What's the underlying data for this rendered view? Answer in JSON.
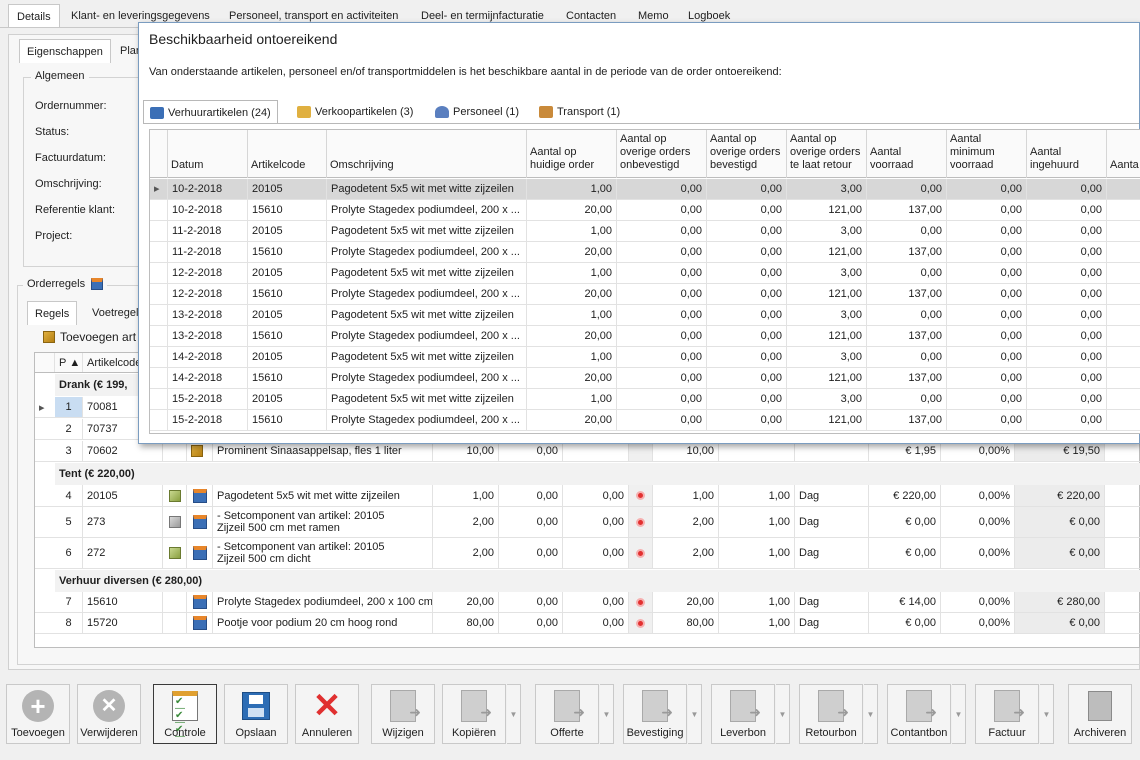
{
  "top_tabs": [
    "Details",
    "Klant- en leveringsgegevens",
    "Personeel, transport en activiteiten",
    "Deel- en termijnfacturatie",
    "Contacten",
    "Memo",
    "Logboek"
  ],
  "sub_tabs": [
    "Eigenschappen",
    "Plan"
  ],
  "general_group": "Algemeen",
  "fields": [
    "Ordernummer:",
    "Status:",
    "Factuurdatum:",
    "Omschrijving:",
    "Referentie klant:",
    "Project:"
  ],
  "orderregels": {
    "title": "Orderregels",
    "tabs": [
      "Regels",
      "Voetregel"
    ],
    "add_label": "Toevoegen art",
    "col_p": "P",
    "col_artikelcode": "Artikelcode",
    "groups": {
      "drank": "Drank  (€ 199,",
      "tent": "Tent  (€ 220,00)",
      "verhuur": "Verhuur diversen  (€ 280,00)"
    },
    "rows": [
      {
        "p": "1",
        "code": "70081"
      },
      {
        "p": "2",
        "code": "70737"
      },
      {
        "p": "3",
        "code": "70602",
        "desc": "Prominent Sinaasappelsap, fles 1 liter",
        "q": "10,00",
        "a": "0,00",
        "c": "10,00",
        "price": "€ 1,95",
        "disc": "0,00%",
        "total": "€ 19,50"
      },
      {
        "p": "4",
        "code": "20105",
        "desc": "Pagodetent 5x5 wit met witte zijzeilen",
        "q": "1,00",
        "a": "0,00",
        "b": "0,00",
        "c": "1,00",
        "d": "1,00",
        "unit": "Dag",
        "price": "€ 220,00",
        "disc": "0,00%",
        "total": "€ 220,00"
      },
      {
        "p": "5",
        "code": "273",
        "desc1": "- Setcomponent van artikel: 20105",
        "desc2": "Zijzeil 500 cm met ramen",
        "q": "2,00",
        "a": "0,00",
        "b": "0,00",
        "c": "2,00",
        "d": "1,00",
        "unit": "Dag",
        "price": "€ 0,00",
        "disc": "0,00%",
        "total": "€ 0,00"
      },
      {
        "p": "6",
        "code": "272",
        "desc1": "- Setcomponent van artikel: 20105",
        "desc2": "Zijzeil 500 cm dicht",
        "q": "2,00",
        "a": "0,00",
        "b": "0,00",
        "c": "2,00",
        "d": "1,00",
        "unit": "Dag",
        "price": "€ 0,00",
        "disc": "0,00%",
        "total": "€ 0,00"
      },
      {
        "p": "7",
        "code": "15610",
        "desc": "Prolyte Stagedex podiumdeel, 200 x 100 cm",
        "q": "20,00",
        "a": "0,00",
        "b": "0,00",
        "c": "20,00",
        "d": "1,00",
        "unit": "Dag",
        "price": "€ 14,00",
        "disc": "0,00%",
        "total": "€ 280,00"
      },
      {
        "p": "8",
        "code": "15720",
        "desc": "Pootje voor podium 20 cm hoog rond",
        "q": "80,00",
        "a": "0,00",
        "b": "0,00",
        "c": "80,00",
        "d": "1,00",
        "unit": "Dag",
        "price": "€ 0,00",
        "disc": "0,00%",
        "total": "€ 0,00"
      }
    ]
  },
  "dialog": {
    "title": "Beschikbaarheid ontoereikend",
    "message": "Van onderstaande artikelen, personeel en/of transportmiddelen is het beschikbare aantal in de periode van de order ontoereikend:",
    "tabs": [
      "Verhuurartikelen (24)",
      "Verkoopartikelen (3)",
      "Personeel (1)",
      "Transport (1)"
    ],
    "columns": [
      "Datum",
      "Artikelcode",
      "Omschrijving",
      "Aantal op huidige order",
      "Aantal op overige orders onbevestigd",
      "Aantal op overige orders bevestigd",
      "Aantal op overige orders te laat retour",
      "Aantal voorraad",
      "Aantal minimum voorraad",
      "Aantal ingehuurd",
      "Aanta onderh"
    ],
    "rows": [
      [
        "10-2-2018",
        "20105",
        "Pagodetent 5x5 wit met witte zijzeilen",
        "1,00",
        "0,00",
        "0,00",
        "3,00",
        "0,00",
        "0,00",
        "0,00"
      ],
      [
        "10-2-2018",
        "15610",
        "Prolyte Stagedex podiumdeel, 200 x ...",
        "20,00",
        "0,00",
        "0,00",
        "121,00",
        "137,00",
        "0,00",
        "0,00"
      ],
      [
        "11-2-2018",
        "20105",
        "Pagodetent 5x5 wit met witte zijzeilen",
        "1,00",
        "0,00",
        "0,00",
        "3,00",
        "0,00",
        "0,00",
        "0,00"
      ],
      [
        "11-2-2018",
        "15610",
        "Prolyte Stagedex podiumdeel, 200 x ...",
        "20,00",
        "0,00",
        "0,00",
        "121,00",
        "137,00",
        "0,00",
        "0,00"
      ],
      [
        "12-2-2018",
        "20105",
        "Pagodetent 5x5 wit met witte zijzeilen",
        "1,00",
        "0,00",
        "0,00",
        "3,00",
        "0,00",
        "0,00",
        "0,00"
      ],
      [
        "12-2-2018",
        "15610",
        "Prolyte Stagedex podiumdeel, 200 x ...",
        "20,00",
        "0,00",
        "0,00",
        "121,00",
        "137,00",
        "0,00",
        "0,00"
      ],
      [
        "13-2-2018",
        "20105",
        "Pagodetent 5x5 wit met witte zijzeilen",
        "1,00",
        "0,00",
        "0,00",
        "3,00",
        "0,00",
        "0,00",
        "0,00"
      ],
      [
        "13-2-2018",
        "15610",
        "Prolyte Stagedex podiumdeel, 200 x ...",
        "20,00",
        "0,00",
        "0,00",
        "121,00",
        "137,00",
        "0,00",
        "0,00"
      ],
      [
        "14-2-2018",
        "20105",
        "Pagodetent 5x5 wit met witte zijzeilen",
        "1,00",
        "0,00",
        "0,00",
        "3,00",
        "0,00",
        "0,00",
        "0,00"
      ],
      [
        "14-2-2018",
        "15610",
        "Prolyte Stagedex podiumdeel, 200 x ...",
        "20,00",
        "0,00",
        "0,00",
        "121,00",
        "137,00",
        "0,00",
        "0,00"
      ],
      [
        "15-2-2018",
        "20105",
        "Pagodetent 5x5 wit met witte zijzeilen",
        "1,00",
        "0,00",
        "0,00",
        "3,00",
        "0,00",
        "0,00",
        "0,00"
      ],
      [
        "15-2-2018",
        "15610",
        "Prolyte Stagedex podiumdeel, 200 x ...",
        "20,00",
        "0,00",
        "0,00",
        "121,00",
        "137,00",
        "0,00",
        "0,00"
      ]
    ]
  },
  "toolbar": {
    "buttons": [
      "Toevoegen",
      "Verwijderen",
      "Controle",
      "Opslaan",
      "Annuleren",
      "Wijzigen",
      "Kopiëren",
      "Offerte",
      "Bevestiging",
      "Leverbon",
      "Retourbon",
      "Contantbon",
      "Factuur",
      "Archiveren"
    ]
  },
  "colors": {
    "accent": "#3b6fb6",
    "selected_row": "#d7d7d7",
    "dialog_border": "#7a9cc0",
    "status_red": "#e23030"
  }
}
